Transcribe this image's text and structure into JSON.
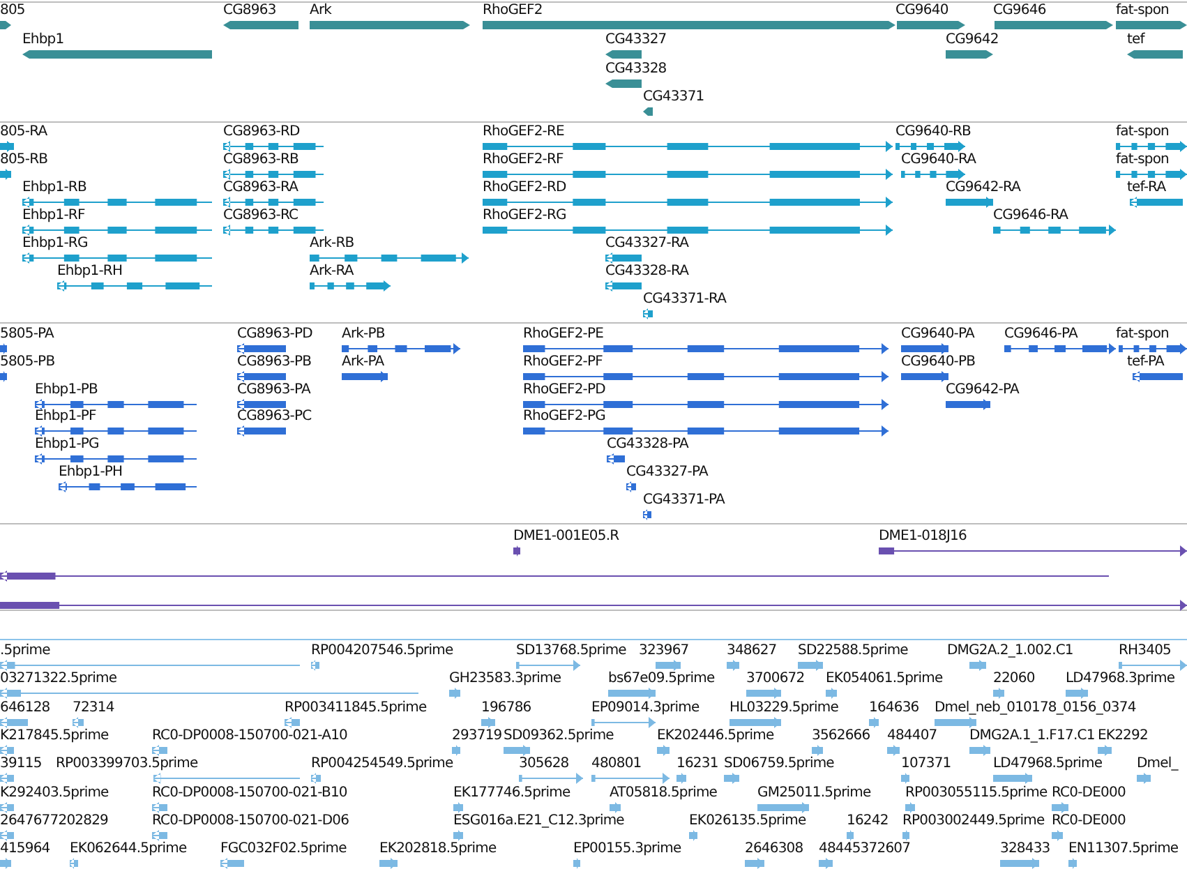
{
  "tracks": [
    {
      "kind": "gene",
      "rows": [
        {
          "features": [
            {
              "label": "805",
              "reverse": false
            },
            {
              "label": "CG8963",
              "reverse": true
            },
            {
              "label": "Ark",
              "reverse": false
            },
            {
              "label": "RhoGEF2",
              "reverse": false
            },
            {
              "label": "CG9640",
              "reverse": false
            },
            {
              "label": "CG9646",
              "reverse": false
            },
            {
              "label": "fat-spon",
              "reverse": false
            }
          ]
        },
        {
          "features": [
            {
              "label": "Ehbp1",
              "reverse": true
            },
            {
              "label": "CG43327",
              "reverse": true
            },
            {
              "label": "CG9642",
              "reverse": false
            },
            {
              "label": "tef",
              "reverse": true
            }
          ]
        },
        {
          "features": [
            {
              "label": "CG43328",
              "reverse": true
            }
          ]
        },
        {
          "features": [
            {
              "label": "CG43371",
              "reverse": true
            }
          ]
        }
      ]
    },
    {
      "kind": "transcript",
      "rows": [
        {
          "features": [
            {
              "label": "805-RA",
              "reverse": false
            },
            {
              "label": "CG8963-RD",
              "reverse": true
            },
            {
              "label": "RhoGEF2-RE",
              "reverse": false
            },
            {
              "label": "CG9640-RB",
              "reverse": false
            },
            {
              "label": "fat-spon",
              "reverse": false
            }
          ]
        },
        {
          "features": [
            {
              "label": "805-RB",
              "reverse": false
            },
            {
              "label": "CG8963-RB",
              "reverse": true
            },
            {
              "label": "RhoGEF2-RF",
              "reverse": false
            },
            {
              "label": "CG9640-RA",
              "reverse": false
            },
            {
              "label": "fat-spon",
              "reverse": false
            }
          ]
        },
        {
          "features": [
            {
              "label": "Ehbp1-RB",
              "reverse": true
            },
            {
              "label": "CG8963-RA",
              "reverse": true
            },
            {
              "label": "RhoGEF2-RD",
              "reverse": false
            },
            {
              "label": "CG9642-RA",
              "reverse": false
            },
            {
              "label": "tef-RA",
              "reverse": true
            }
          ]
        },
        {
          "features": [
            {
              "label": "Ehbp1-RF",
              "reverse": true
            },
            {
              "label": "CG8963-RC",
              "reverse": true
            },
            {
              "label": "RhoGEF2-RG",
              "reverse": false
            },
            {
              "label": "CG9646-RA",
              "reverse": false
            }
          ]
        },
        {
          "features": [
            {
              "label": "Ehbp1-RG",
              "reverse": true
            },
            {
              "label": "Ark-RB",
              "reverse": false
            },
            {
              "label": "CG43327-RA",
              "reverse": true
            }
          ]
        },
        {
          "features": [
            {
              "label": "Ehbp1-RH",
              "reverse": true
            },
            {
              "label": "Ark-RA",
              "reverse": false
            },
            {
              "label": "CG43328-RA",
              "reverse": true
            }
          ]
        },
        {
          "features": [
            {
              "label": "CG43371-RA",
              "reverse": true
            }
          ]
        }
      ]
    },
    {
      "kind": "protein",
      "rows": [
        {
          "features": [
            {
              "label": "5805-PA",
              "reverse": false
            },
            {
              "label": "CG8963-PD",
              "reverse": true
            },
            {
              "label": "Ark-PB",
              "reverse": false
            },
            {
              "label": "RhoGEF2-PE",
              "reverse": false
            },
            {
              "label": "CG9640-PA",
              "reverse": false
            },
            {
              "label": "CG9646-PA",
              "reverse": false
            },
            {
              "label": "fat-spon",
              "reverse": false
            }
          ]
        },
        {
          "features": [
            {
              "label": "5805-PB",
              "reverse": false
            },
            {
              "label": "CG8963-PB",
              "reverse": true
            },
            {
              "label": "Ark-PA",
              "reverse": false
            },
            {
              "label": "RhoGEF2-PF",
              "reverse": false
            },
            {
              "label": "CG9640-PB",
              "reverse": false
            },
            {
              "label": "tef-PA",
              "reverse": true
            }
          ]
        },
        {
          "features": [
            {
              "label": "Ehbp1-PB",
              "reverse": true
            },
            {
              "label": "CG8963-PA",
              "reverse": true
            },
            {
              "label": "RhoGEF2-PD",
              "reverse": false
            },
            {
              "label": "CG9642-PA",
              "reverse": false
            }
          ]
        },
        {
          "features": [
            {
              "label": "Ehbp1-PF",
              "reverse": true
            },
            {
              "label": "CG8963-PC",
              "reverse": true
            },
            {
              "label": "RhoGEF2-PG",
              "reverse": false
            }
          ]
        },
        {
          "features": [
            {
              "label": "Ehbp1-PG",
              "reverse": true
            },
            {
              "label": "CG43328-PA",
              "reverse": true
            }
          ]
        },
        {
          "features": [
            {
              "label": "Ehbp1-PH",
              "reverse": true
            },
            {
              "label": "CG43327-PA",
              "reverse": true
            }
          ]
        },
        {
          "features": [
            {
              "label": "CG43371-PA",
              "reverse": true
            }
          ]
        }
      ]
    },
    {
      "kind": "clone",
      "rows": [
        {
          "features": [
            {
              "label": "DME1-001E05.R",
              "reverse": false
            },
            {
              "label": "DME1-018J16",
              "reverse": false
            }
          ]
        },
        {
          "features": [
            {
              "reverse": true
            }
          ]
        },
        {
          "features": [
            {
              "reverse": false
            }
          ]
        }
      ]
    },
    {
      "kind": "est",
      "rows": [
        {
          "features": [
            {
              "label": ".5prime",
              "reverse": true
            },
            {
              "label": "RP004207546.5prime",
              "reverse": true
            },
            {
              "label": "SD13768.5prime",
              "reverse": false
            },
            {
              "label": "323967",
              "reverse": false
            },
            {
              "label": "348627",
              "reverse": false
            },
            {
              "label": "SD22588.5prime",
              "reverse": false
            },
            {
              "label": "DMG2A.2_1.002.C1",
              "reverse": false
            },
            {
              "label": "RH3405",
              "reverse": false
            }
          ]
        },
        {
          "features": [
            {
              "label": "03271322.5prime",
              "reverse": true
            },
            {
              "label": "GH23583.3prime",
              "reverse": false
            },
            {
              "label": "bs67e09.5prime",
              "reverse": false
            },
            {
              "label": "3700672",
              "reverse": false
            },
            {
              "label": "EK054061.5prime",
              "reverse": false
            },
            {
              "label": "22060",
              "reverse": false
            },
            {
              "label": "LD47968.3prime",
              "reverse": false
            }
          ]
        },
        {
          "features": [
            {
              "label": "646128",
              "reverse": true
            },
            {
              "label": "72314",
              "reverse": true
            },
            {
              "label": "RP003411845.5prime",
              "reverse": true
            },
            {
              "label": "196786",
              "reverse": false
            },
            {
              "label": "EP09014.3prime",
              "reverse": false
            },
            {
              "label": "HL03229.5prime",
              "reverse": false
            },
            {
              "label": "164636",
              "reverse": false
            },
            {
              "label": "Dmel_neb_010178_0156_0374",
              "reverse": false
            }
          ]
        },
        {
          "features": [
            {
              "label": "K217845.5prime",
              "reverse": true
            },
            {
              "label": "RC0-DP0008-150700-021-A10",
              "reverse": true
            },
            {
              "label": "293719",
              "reverse": false
            },
            {
              "label": "SD09362.5prime",
              "reverse": false
            },
            {
              "label": "EK202446.5prime",
              "reverse": false
            },
            {
              "label": "3562666",
              "reverse": false
            },
            {
              "label": "484407",
              "reverse": false
            },
            {
              "label": "DMG2A.1_1.F17.C1",
              "reverse": false
            },
            {
              "label": "EK2292",
              "reverse": false
            }
          ]
        },
        {
          "features": [
            {
              "label": "39115",
              "reverse": true
            },
            {
              "label": "RP003399703.5prime",
              "reverse": true
            },
            {
              "label": "RP004254549.5prime",
              "reverse": true
            },
            {
              "label": "305628",
              "reverse": false
            },
            {
              "label": "480801",
              "reverse": false
            },
            {
              "label": "16231",
              "reverse": false
            },
            {
              "label": "SD06759.5prime",
              "reverse": false
            },
            {
              "label": "107371",
              "reverse": false
            },
            {
              "label": "LD47968.5prime",
              "reverse": false
            },
            {
              "label": "Dmel_",
              "reverse": false
            }
          ]
        },
        {
          "features": [
            {
              "label": "K292403.5prime",
              "reverse": true
            },
            {
              "label": "RC0-DP0008-150700-021-B10",
              "reverse": true
            },
            {
              "label": "EK177746.5prime",
              "reverse": false
            },
            {
              "label": "AT05818.5prime",
              "reverse": false
            },
            {
              "label": "GM25011.5prime",
              "reverse": false
            },
            {
              "label": "RP003055115.5prime",
              "reverse": false
            },
            {
              "label": "RC0-DE000",
              "reverse": false
            }
          ]
        },
        {
          "features": [
            {
              "label": "2647677202829",
              "reverse": true
            },
            {
              "label": "RC0-DP0008-150700-021-D06",
              "reverse": true
            },
            {
              "label": "ESG016a.E21_C12.3prime",
              "reverse": false
            },
            {
              "label": "EK026135.5prime",
              "reverse": false
            },
            {
              "label": "16242",
              "reverse": false
            },
            {
              "label": "RP003002449.5prime",
              "reverse": false
            },
            {
              "label": "RC0-DE000",
              "reverse": false
            }
          ]
        },
        {
          "features": [
            {
              "label": "415964",
              "reverse": false
            },
            {
              "label": "EK062644.5prime",
              "reverse": true
            },
            {
              "label": "FGC032F02.5prime",
              "reverse": true
            },
            {
              "label": "EK202818.5prime",
              "reverse": false
            },
            {
              "label": "EP00155.3prime",
              "reverse": false
            },
            {
              "label": "2646308",
              "reverse": false
            },
            {
              "label": "48445372607",
              "reverse": false
            },
            {
              "label": "328433",
              "reverse": false
            },
            {
              "label": "EN11307.5prime",
              "reverse": false
            }
          ]
        }
      ]
    }
  ]
}
